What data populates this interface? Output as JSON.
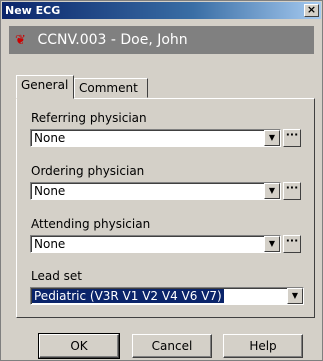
{
  "window": {
    "title": "New ECG",
    "close_label": "×"
  },
  "patient": {
    "icon": "ecg-heart-icon",
    "text": "CCNV.003 - Doe, John"
  },
  "tabs": [
    {
      "label": "General",
      "active": true
    },
    {
      "label": "Comment",
      "active": false
    }
  ],
  "fields": {
    "referring": {
      "label": "Referring physician",
      "value": "None"
    },
    "ordering": {
      "label": "Ordering physician",
      "value": "None"
    },
    "attending": {
      "label": "Attending physician",
      "value": "None"
    },
    "lead_set": {
      "label": "Lead set",
      "value": "Pediatric (V3R V1 V2 V4 V6 V7)"
    }
  },
  "buttons": {
    "ok": "OK",
    "cancel": "Cancel",
    "help": "Help"
  }
}
